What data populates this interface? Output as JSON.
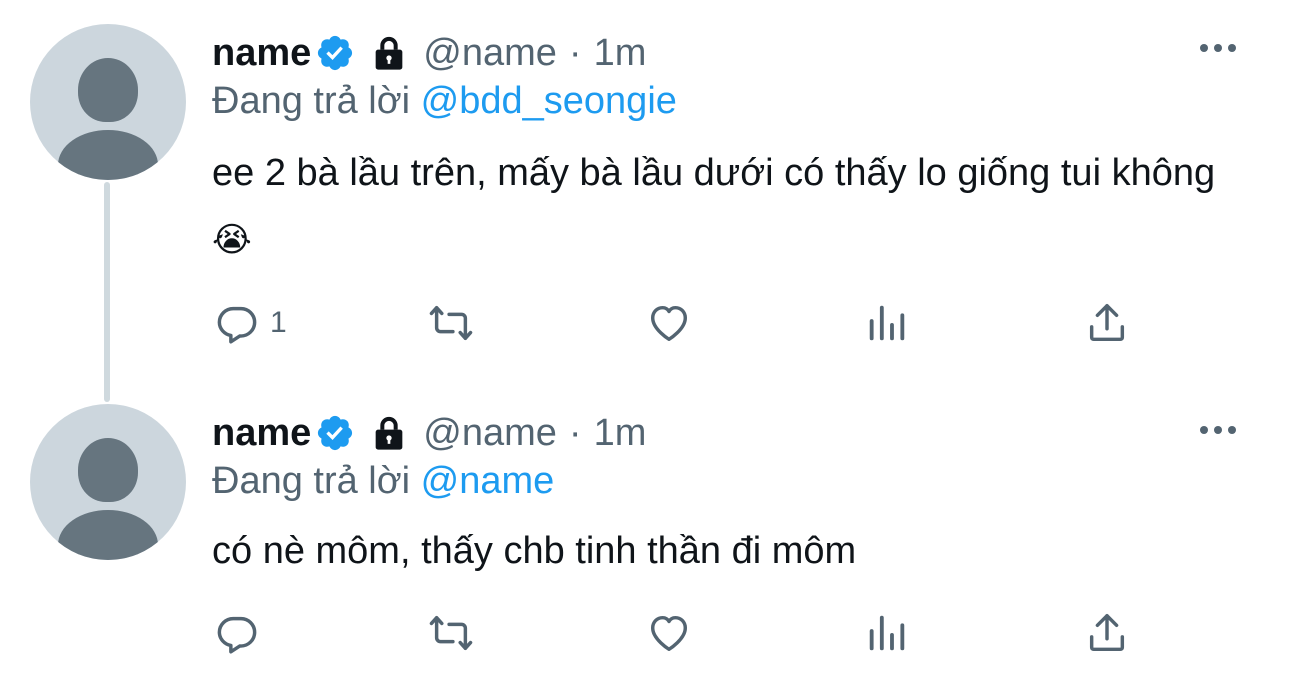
{
  "tweets": [
    {
      "name": "name",
      "handle": "@name",
      "separator": "·",
      "time": "1m",
      "reply_prefix": "Đang trả lời",
      "reply_mention": "@bdd_seongie",
      "text": "ee 2 bà lầu trên, mấy bà lầu dưới có thấy lo giống tui không",
      "emoji": "😭",
      "reply_count": "1"
    },
    {
      "name": "name",
      "handle": "@name",
      "separator": "·",
      "time": "1m",
      "reply_prefix": "Đang trả lời",
      "reply_mention": "@name",
      "text": "có nè môm, thấy chb tinh thần đi môm",
      "emoji": "",
      "reply_count": ""
    }
  ],
  "icons": [
    "verified-icon",
    "lock-icon",
    "more-icon",
    "reply-icon",
    "retweet-icon",
    "like-icon",
    "analytics-icon",
    "share-icon"
  ],
  "colors": {
    "accent": "#1d9bf0",
    "muted": "#536471",
    "text": "#0f1419",
    "thread_line": "#cfd9de"
  }
}
